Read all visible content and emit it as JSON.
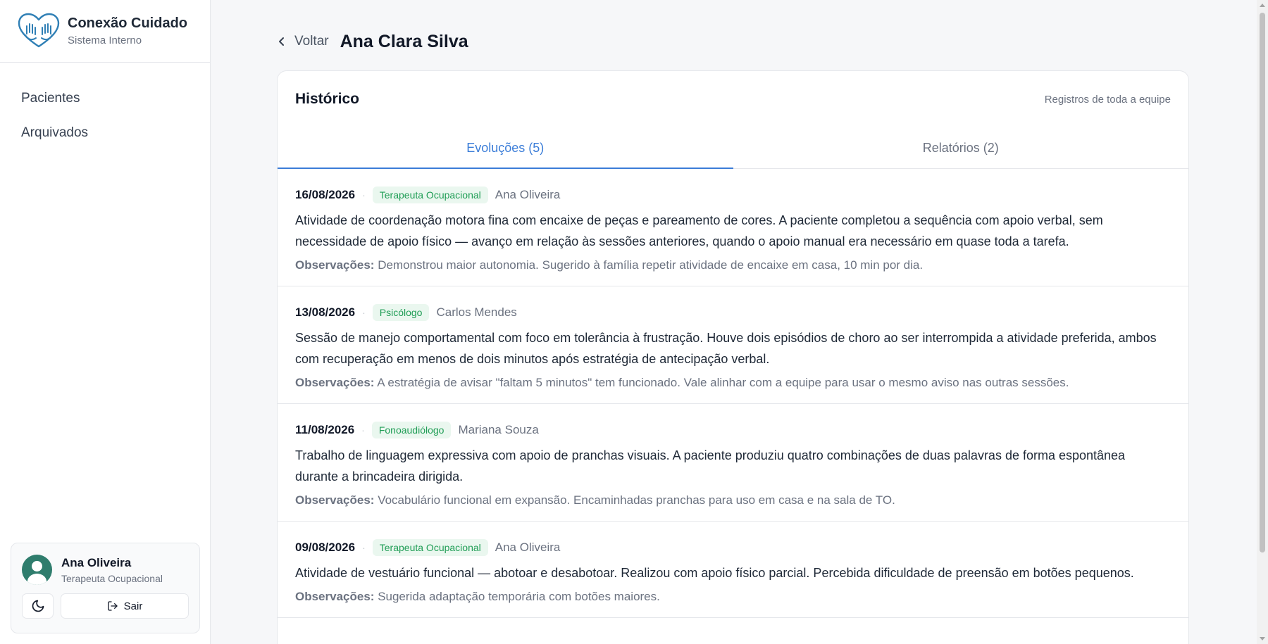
{
  "brand": {
    "title": "Conexão Cuidado",
    "subtitle": "Sistema Interno",
    "icon": "heart-hands-icon"
  },
  "nav": {
    "items": [
      {
        "label": "Pacientes"
      },
      {
        "label": "Arquivados"
      }
    ]
  },
  "user": {
    "name": "Ana Oliveira",
    "role": "Terapeuta Ocupacional",
    "theme_icon": "moon-icon",
    "logout_label": "Sair",
    "logout_icon": "logout-icon"
  },
  "header": {
    "back_label": "Voltar",
    "patient_name": "Ana Clara Silva"
  },
  "history": {
    "title": "Histórico",
    "note": "Registros de toda a equipe",
    "tabs": [
      {
        "label": "Evoluções (5)",
        "active": true
      },
      {
        "label": "Relatórios (2)",
        "active": false
      }
    ],
    "obs_label": "Observações:",
    "entries": [
      {
        "date": "16/08/2026",
        "role": "Terapeuta Ocupacional",
        "author": "Ana Oliveira",
        "text": "Atividade de coordenação motora fina com encaixe de peças e pareamento de cores. A paciente completou a sequência com apoio verbal, sem necessidade de apoio físico — avanço em relação às sessões anteriores, quando o apoio manual era necessário em quase toda a tarefa.",
        "obs": "Demonstrou maior autonomia. Sugerido à família repetir atividade de encaixe em casa, 10 min por dia."
      },
      {
        "date": "13/08/2026",
        "role": "Psicólogo",
        "author": "Carlos Mendes",
        "text": "Sessão de manejo comportamental com foco em tolerância à frustração. Houve dois episódios de choro ao ser interrompida a atividade preferida, ambos com recuperação em menos de dois minutos após estratégia de antecipação verbal.",
        "obs": "A estratégia de avisar \"faltam 5 minutos\" tem funcionado. Vale alinhar com a equipe para usar o mesmo aviso nas outras sessões."
      },
      {
        "date": "11/08/2026",
        "role": "Fonoaudiólogo",
        "author": "Mariana Souza",
        "text": "Trabalho de linguagem expressiva com apoio de pranchas visuais. A paciente produziu quatro combinações de duas palavras de forma espontânea durante a brincadeira dirigida.",
        "obs": "Vocabulário funcional em expansão. Encaminhadas pranchas para uso em casa e na sala de TO."
      },
      {
        "date": "09/08/2026",
        "role": "Terapeuta Ocupacional",
        "author": "Ana Oliveira",
        "text": "Atividade de vestuário funcional — abotoar e desabotoar. Realizou com apoio físico parcial. Percebida dificuldade de preensão em botões pequenos.",
        "obs": "Sugerida adaptação temporária com botões maiores."
      }
    ]
  }
}
